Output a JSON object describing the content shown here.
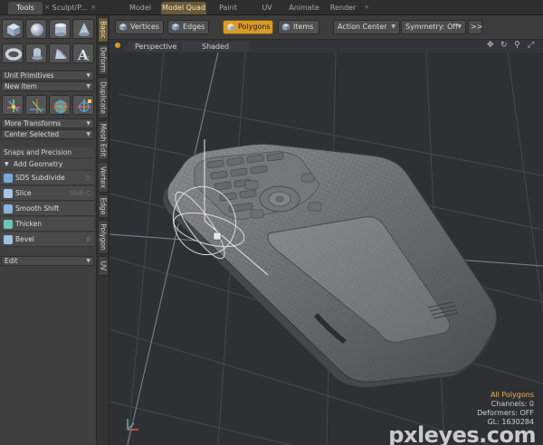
{
  "top_tabs": {
    "left": [
      {
        "label": "Tools",
        "state": "active"
      },
      {
        "label": "Sculpt/P...",
        "state": "normal"
      }
    ],
    "right": [
      {
        "label": "Model",
        "state": "normal"
      },
      {
        "label": "Model Quad",
        "state": "selected"
      },
      {
        "label": "Paint",
        "state": "normal"
      },
      {
        "label": "UV",
        "state": "normal"
      },
      {
        "label": "Animate",
        "state": "normal"
      },
      {
        "label": "Render",
        "state": "normal"
      }
    ],
    "close_glyph": "×",
    "add_glyph": "+"
  },
  "left_panel": {
    "icons_row1": [
      "cube-icon",
      "sphere-icon",
      "cylinder-icon",
      "cone-icon"
    ],
    "icons_row2": [
      "torus-icon",
      "capsule-icon",
      "wedge-icon",
      "text-icon"
    ],
    "icons_row3": [
      "move-icon",
      "rotate-icon",
      "scale-icon",
      "transform-icon"
    ],
    "unit_primitives": "Unit Primitives",
    "new_item": "New Item",
    "more_transforms": "More Transforms",
    "center_selected": "Center Selected",
    "snaps": "Snaps and Precision",
    "add_geometry": "Add Geometry",
    "tools": [
      {
        "label": "SDS Subdivide",
        "shortcut": "D",
        "icon_color": "#7aa8d8"
      },
      {
        "label": "Slice",
        "shortcut": "Shift-C",
        "icon_color": "#a9c4e6"
      },
      {
        "label": "Smooth Shift",
        "shortcut": "",
        "icon_color": "#8ab4dc"
      },
      {
        "label": "Thicken",
        "shortcut": "",
        "icon_color": "#6fc4b8"
      },
      {
        "label": "Bevel",
        "shortcut": "B",
        "icon_color": "#9fc0dc"
      }
    ],
    "edit": "Edit"
  },
  "vertical_tabs": [
    {
      "label": "Basic",
      "state": "active"
    },
    {
      "label": "Deform",
      "state": "normal"
    },
    {
      "label": "Duplicate",
      "state": "normal"
    },
    {
      "label": "Mesh Edit",
      "state": "normal"
    },
    {
      "label": "Vertex",
      "state": "normal"
    },
    {
      "label": "Edge",
      "state": "normal"
    },
    {
      "label": "Polygon",
      "state": "normal"
    },
    {
      "label": "UV",
      "state": "normal"
    }
  ],
  "toolbar": {
    "vertices": "Vertices",
    "edges": "Edges",
    "polygons": "Polygons",
    "items": "Items",
    "action_center": "Action Center",
    "symmetry": "Symmetry: Off",
    "more": ">>",
    "active_mode": "polygons",
    "accent_color": "#d99a2a"
  },
  "viewport": {
    "view": "Perspective",
    "shading": "Shaded",
    "nav_icons": [
      "move-view-icon",
      "rotate-view-icon",
      "zoom-view-icon",
      "maximize-view-icon"
    ],
    "info": {
      "selection": "All Polygons",
      "channels": "Channels: 0",
      "deformers": "Deformers: OFF",
      "gl": "GL: 1630284"
    },
    "watermark": "pxleyes.com"
  }
}
